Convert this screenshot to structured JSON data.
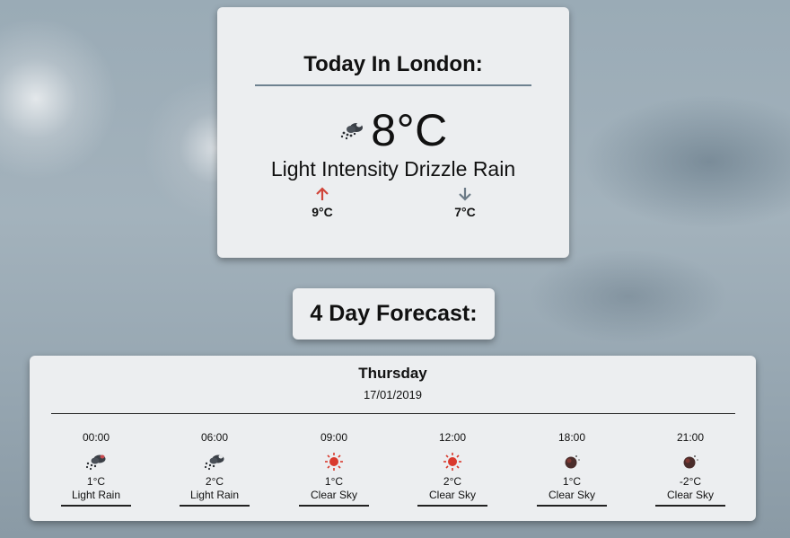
{
  "today": {
    "title": "Today In London:",
    "temperature": "8°C",
    "icon": "rain-cloud-icon",
    "description": "Light Intensity Drizzle Rain",
    "max": "9°C",
    "min": "7°C",
    "colors": {
      "max_arrow": "#d0453a",
      "min_arrow": "#6b7a86"
    }
  },
  "forecast": {
    "title": "4 Day Forecast:",
    "day": {
      "name": "Thursday",
      "date": "17/01/2019",
      "slots": [
        {
          "time": "00:00",
          "temp": "1°C",
          "desc": "Light Rain",
          "icon": "rain-cloud-icon"
        },
        {
          "time": "06:00",
          "temp": "2°C",
          "desc": "Light Rain",
          "icon": "rain-cloud-icon"
        },
        {
          "time": "09:00",
          "temp": "1°C",
          "desc": "Clear Sky",
          "icon": "sun-icon"
        },
        {
          "time": "12:00",
          "temp": "2°C",
          "desc": "Clear Sky",
          "icon": "sun-icon"
        },
        {
          "time": "18:00",
          "temp": "1°C",
          "desc": "Clear Sky",
          "icon": "moon-icon"
        },
        {
          "time": "21:00",
          "temp": "-2°C",
          "desc": "Clear Sky",
          "icon": "moon-icon"
        }
      ]
    }
  }
}
